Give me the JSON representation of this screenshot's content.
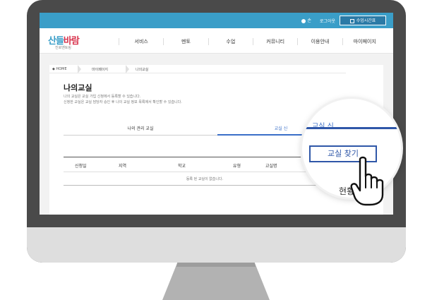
{
  "site": {
    "logo_text_a": "산들",
    "logo_text_b": "바람",
    "logo_sub": "진로멘토링"
  },
  "topbar": {
    "user": "손",
    "logout": "로그아웃",
    "schedule": "수업시간표"
  },
  "nav": {
    "items": [
      "서비스",
      "멘토",
      "수업",
      "커뮤니티",
      "이용안내",
      "마이페이지"
    ]
  },
  "breadcrumb": {
    "home": "◆ HOME",
    "mypage": "마이페이지",
    "current": "나의교실"
  },
  "page": {
    "title": "나의교실",
    "desc1": "나의 교실은 교실 가입 신청에서 등록할 수 있습니다.",
    "desc2": "신청한 교실은 교실 담당자 승인 후 나의 교실 정보 목록에서 확인할 수 있습니다."
  },
  "tabs": {
    "managed": "나의 관리 교실",
    "applied": "교실 신"
  },
  "table": {
    "headers": [
      "신청일",
      "지역",
      "학교",
      "유형",
      "교실명"
    ],
    "empty_message": "등록 된 교실이 없습니다."
  },
  "magnifier": {
    "tab_label": "교실 신",
    "find_button": "교실 찾기",
    "status": "현황"
  },
  "colors": {
    "topbar": "#3a9ec8",
    "accent": "#2f57a8"
  }
}
